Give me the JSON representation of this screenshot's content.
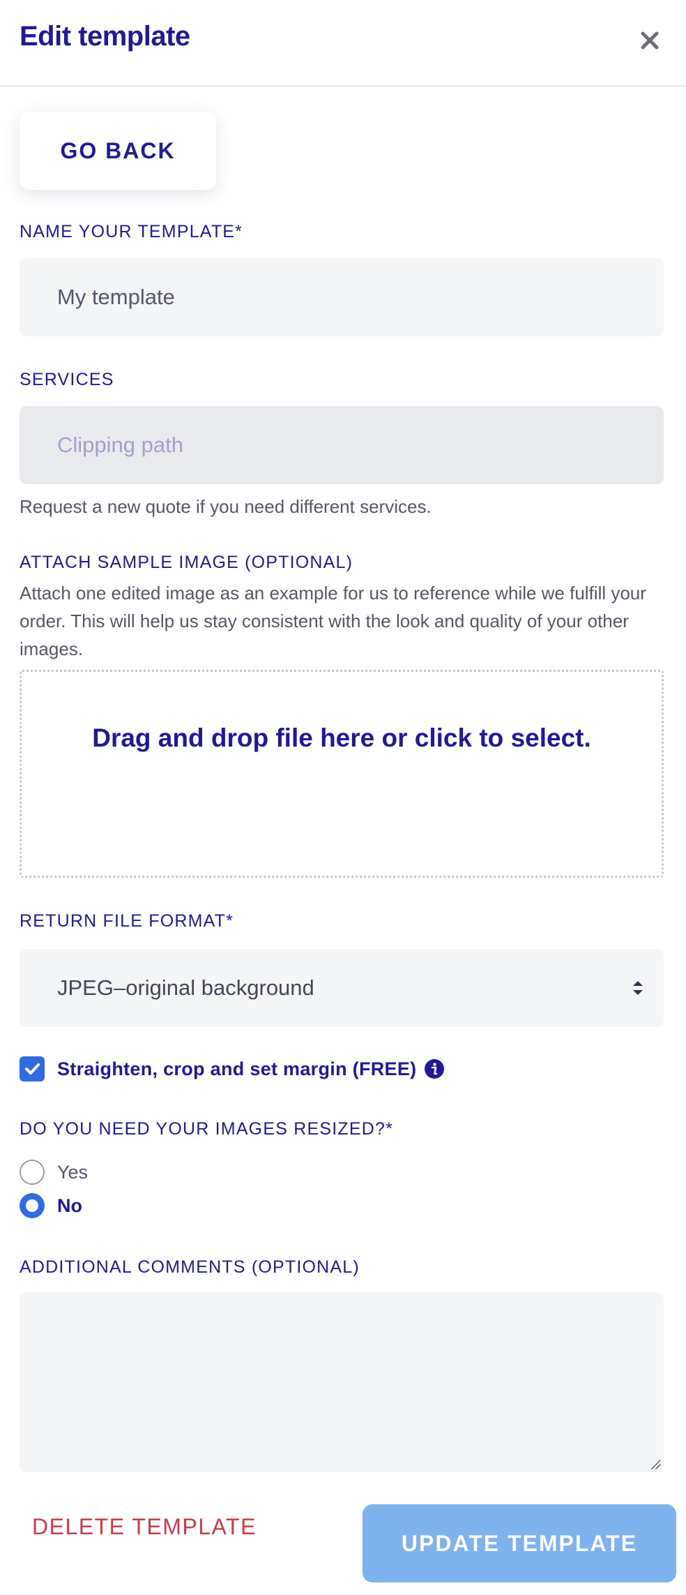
{
  "header": {
    "title": "Edit template",
    "close_icon": "close-icon"
  },
  "go_back_label": "GO BACK",
  "name_section": {
    "label": "NAME YOUR TEMPLATE*",
    "value": "My template"
  },
  "services_section": {
    "label": "SERVICES",
    "value": "Clipping path",
    "help": "Request a new quote if you need different services."
  },
  "sample_section": {
    "label": "ATTACH SAMPLE IMAGE (OPTIONAL)",
    "description": "Attach one edited image as an example for us to reference while we fulfill your order. This will help us stay consistent with the look and quality of your other images.",
    "dropzone_text": "Drag and drop file here or click to select."
  },
  "format_section": {
    "label": "RETURN FILE FORMAT*",
    "selected": "JPEG–original background"
  },
  "straighten": {
    "label": "Straighten, crop and set margin (FREE)",
    "checked": true,
    "info_icon": "info-icon"
  },
  "resize_section": {
    "label": "DO YOU NEED YOUR IMAGES RESIZED?*",
    "options": [
      {
        "label": "Yes",
        "selected": false
      },
      {
        "label": "No",
        "selected": true
      }
    ]
  },
  "comments_section": {
    "label": "ADDITIONAL COMMENTS (OPTIONAL)",
    "value": ""
  },
  "footer": {
    "delete_label": "DELETE TEMPLATE",
    "update_label": "UPDATE TEMPLATE"
  },
  "colors": {
    "brand": "#22189a",
    "accent": "#2e6ce4",
    "danger": "#d13a45",
    "update_button": "#7eb2ee"
  }
}
